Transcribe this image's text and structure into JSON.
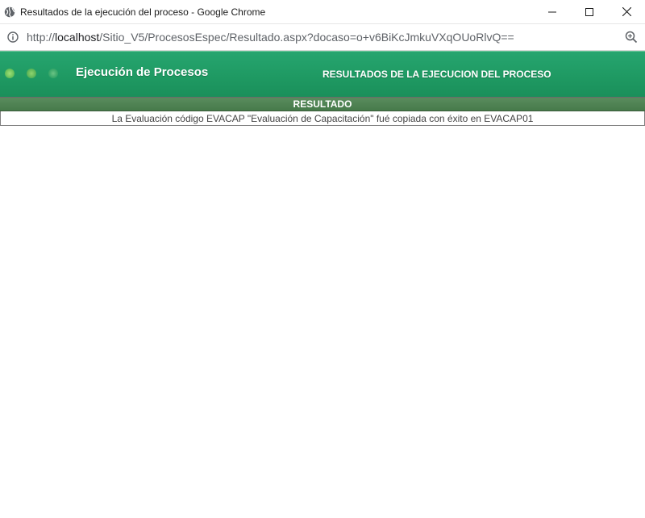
{
  "window": {
    "title": "Resultados de la ejecución del proceso - Google Chrome",
    "controls": {
      "minimize": "—",
      "maximize": "☐",
      "close": "✕"
    }
  },
  "address": {
    "url_prefix": "http://",
    "url_host": "localhost",
    "url_path": "/Sitio_V5/ProcesosEspec/Resultado.aspx?docaso=o+v6BiKcJmkuVXqOUoRlvQ=="
  },
  "banner": {
    "left_title": "Ejecución de Procesos",
    "right_title": "RESULTADOS DE LA EJECUCION DEL PROCESO"
  },
  "result": {
    "header": "RESULTADO",
    "message": "La Evaluación código EVACAP \"Evaluación de Capacitación\" fué copiada con éxito en EVACAP01"
  },
  "colors": {
    "banner_green": "#1f9a63",
    "header_green": "#4a7f52"
  }
}
